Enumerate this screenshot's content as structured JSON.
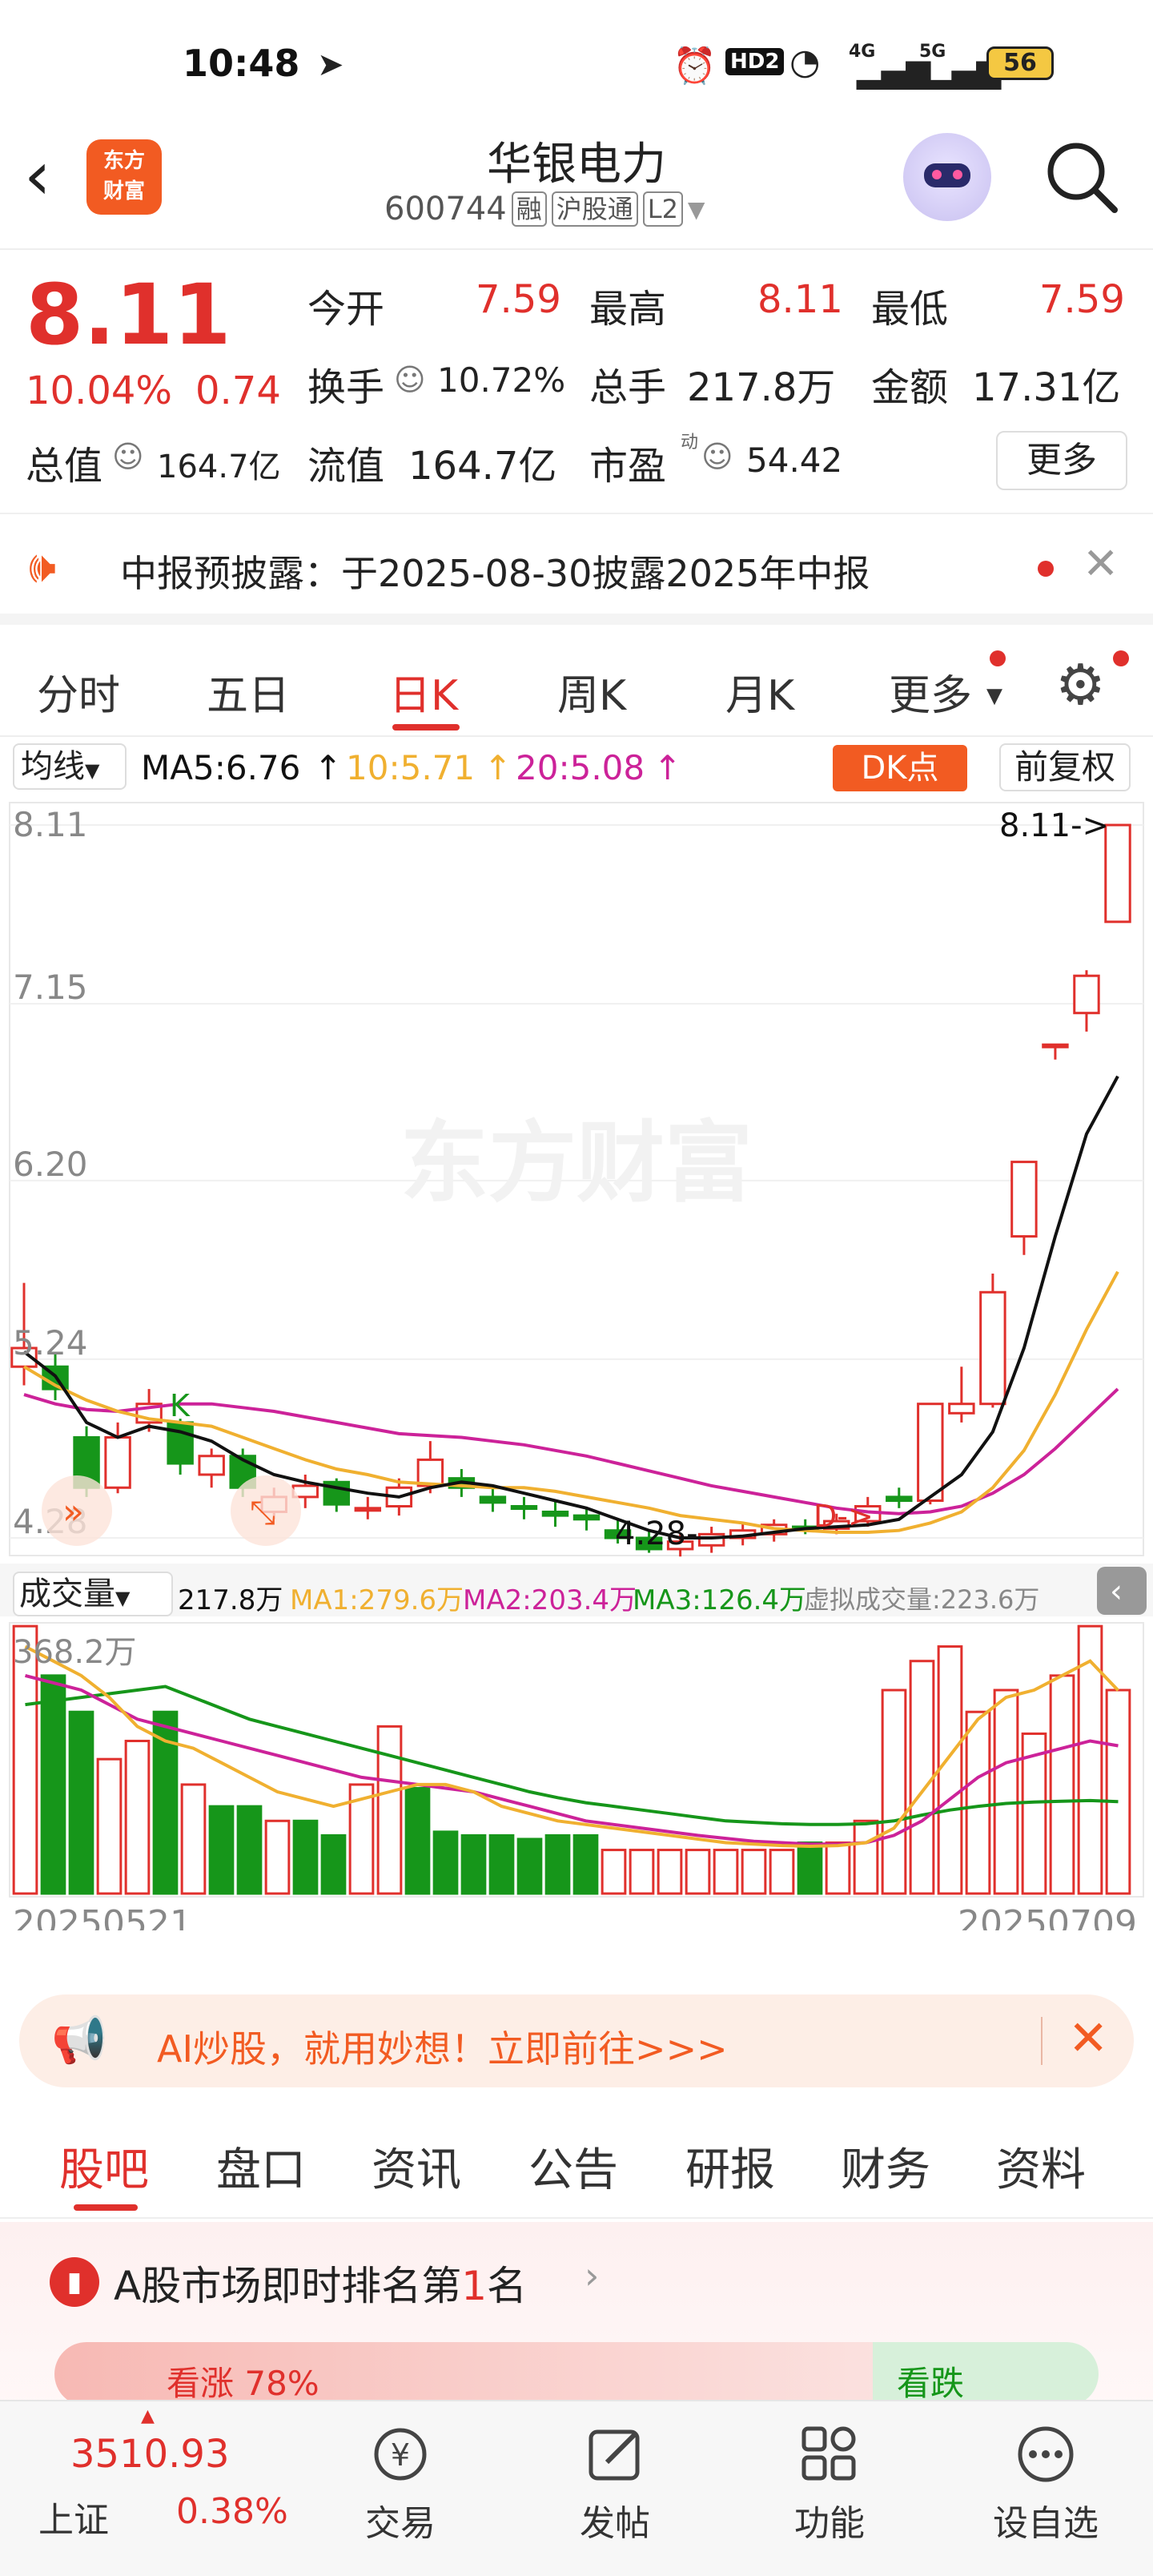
{
  "status_bar": {
    "time": "10:48",
    "hd": "HD2",
    "net4g": "4G",
    "net5g": "5G",
    "battery": "56"
  },
  "header": {
    "logo_text_1": "东方",
    "logo_text_2": "财富",
    "title": "华银电力",
    "code": "600744",
    "tag_rong": "融",
    "tag_hgt": "沪股通",
    "tag_l2": "L2"
  },
  "quote": {
    "price": "8.11",
    "change_pct": "10.04%",
    "change_amt": "0.74",
    "open_label": "今开",
    "open": "7.59",
    "high_label": "最高",
    "high": "8.11",
    "low_label": "最低",
    "low": "7.59",
    "turnover_label": "换手",
    "turnover": "10.72%",
    "volume_label": "总手",
    "volume": "217.8万",
    "amount_label": "金额",
    "amount": "17.31亿",
    "mktcap_label": "总值",
    "mktcap": "164.7亿",
    "float_label": "流值",
    "float": "164.7亿",
    "pe_label": "市盈",
    "pe_sup": "动",
    "pe": "54.42",
    "more": "更多"
  },
  "notice": {
    "text": "中报预披露：于2025-08-30披露2025年中报"
  },
  "period_tabs": [
    "分时",
    "五日",
    "日K",
    "周K",
    "月K",
    "更多"
  ],
  "ma_bar": {
    "selector": "均线",
    "ma5": "MA5:6.76",
    "ma10": "10:5.71",
    "ma20": "20:5.08",
    "dk": "DK点",
    "adjust": "前复权"
  },
  "price_axis": [
    "8.11",
    "7.15",
    "6.20",
    "5.24",
    "4.28"
  ],
  "chart_annotations": {
    "last": "8.11->",
    "low": "4.28-",
    "k_mark": "K",
    "d_mark": "D->",
    "watermark": "东方财富"
  },
  "volume_bar": {
    "selector": "成交量",
    "vol": "217.8万",
    "ma1": "MA1:279.6万",
    "ma2": "MA2:203.4万",
    "ma3": "MA3:126.4万",
    "virtual": "虚拟成交量:223.6万",
    "max": "368.2万"
  },
  "dates": {
    "start": "20250521",
    "end": "20250709"
  },
  "colors": {
    "up": "#e0302c",
    "down": "#16961a",
    "ma5": "#111111",
    "ma10": "#f0b030",
    "ma20": "#cc2299",
    "vma3": "#16961a"
  },
  "chart_data": [
    {
      "type": "candlestick",
      "title": "日K",
      "ylim": [
        4.28,
        8.11
      ],
      "x_start": "20250521",
      "x_end": "20250709",
      "candles": [
        {
          "o": 5.2,
          "c": 5.3,
          "h": 5.65,
          "l": 5.1
        },
        {
          "o": 5.2,
          "c": 5.08,
          "h": 5.28,
          "l": 5.02
        },
        {
          "o": 4.82,
          "c": 4.55,
          "h": 4.88,
          "l": 4.5
        },
        {
          "o": 4.55,
          "c": 4.82,
          "h": 4.9,
          "l": 4.52
        },
        {
          "o": 4.9,
          "c": 5.0,
          "h": 5.08,
          "l": 4.85
        },
        {
          "o": 4.9,
          "c": 4.68,
          "h": 4.92,
          "l": 4.62
        },
        {
          "o": 4.62,
          "c": 4.72,
          "h": 4.76,
          "l": 4.55
        },
        {
          "o": 4.72,
          "c": 4.55,
          "h": 4.76,
          "l": 4.5
        },
        {
          "o": 4.42,
          "c": 4.5,
          "h": 4.55,
          "l": 4.38
        },
        {
          "o": 4.5,
          "c": 4.56,
          "h": 4.62,
          "l": 4.44
        },
        {
          "o": 4.58,
          "c": 4.46,
          "h": 4.6,
          "l": 4.42
        },
        {
          "o": 4.44,
          "c": 4.44,
          "h": 4.5,
          "l": 4.38
        },
        {
          "o": 4.45,
          "c": 4.55,
          "h": 4.6,
          "l": 4.4
        },
        {
          "o": 4.56,
          "c": 4.7,
          "h": 4.8,
          "l": 4.52
        },
        {
          "o": 4.6,
          "c": 4.55,
          "h": 4.65,
          "l": 4.5
        },
        {
          "o": 4.5,
          "c": 4.47,
          "h": 4.55,
          "l": 4.42
        },
        {
          "o": 4.45,
          "c": 4.44,
          "h": 4.5,
          "l": 4.38
        },
        {
          "o": 4.42,
          "c": 4.4,
          "h": 4.48,
          "l": 4.34
        },
        {
          "o": 4.4,
          "c": 4.38,
          "h": 4.44,
          "l": 4.32
        },
        {
          "o": 4.32,
          "c": 4.28,
          "h": 4.38,
          "l": 4.25
        },
        {
          "o": 4.28,
          "c": 4.22,
          "h": 4.32,
          "l": 4.2
        },
        {
          "o": 4.22,
          "c": 4.26,
          "h": 4.3,
          "l": 4.18
        },
        {
          "o": 4.24,
          "c": 4.3,
          "h": 4.34,
          "l": 4.2
        },
        {
          "o": 4.28,
          "c": 4.32,
          "h": 4.36,
          "l": 4.24
        },
        {
          "o": 4.3,
          "c": 4.35,
          "h": 4.38,
          "l": 4.26
        },
        {
          "o": 4.34,
          "c": 4.33,
          "h": 4.38,
          "l": 4.3
        },
        {
          "o": 4.33,
          "c": 4.37,
          "h": 4.41,
          "l": 4.3
        },
        {
          "o": 4.37,
          "c": 4.45,
          "h": 4.5,
          "l": 4.34
        },
        {
          "o": 4.5,
          "c": 4.48,
          "h": 4.55,
          "l": 4.44
        },
        {
          "o": 4.48,
          "c": 5.0,
          "h": 5.0,
          "l": 4.46
        },
        {
          "o": 4.95,
          "c": 5.0,
          "h": 5.2,
          "l": 4.9
        },
        {
          "o": 5.0,
          "c": 5.6,
          "h": 5.7,
          "l": 4.98
        },
        {
          "o": 5.9,
          "c": 6.3,
          "h": 6.3,
          "l": 5.8
        },
        {
          "o": 6.93,
          "c": 6.93,
          "h": 6.93,
          "l": 6.85
        },
        {
          "o": 7.1,
          "c": 7.3,
          "h": 7.33,
          "l": 7.0
        },
        {
          "o": 7.59,
          "c": 8.11,
          "h": 8.11,
          "l": 7.59
        }
      ],
      "ma5_points": [
        5.28,
        5.15,
        4.9,
        4.82,
        4.88,
        4.85,
        4.8,
        4.7,
        4.62,
        4.58,
        4.55,
        4.52,
        4.5,
        4.55,
        4.58,
        4.56,
        4.52,
        4.48,
        4.44,
        4.38,
        4.32,
        4.28,
        4.28,
        4.29,
        4.31,
        4.33,
        4.34,
        4.35,
        4.38,
        4.5,
        4.62,
        4.85,
        5.3,
        5.9,
        6.45,
        6.76
      ],
      "ma10_points": [
        5.2,
        5.1,
        5.02,
        4.96,
        4.92,
        4.9,
        4.88,
        4.82,
        4.76,
        4.7,
        4.65,
        4.62,
        4.58,
        4.57,
        4.56,
        4.55,
        4.55,
        4.53,
        4.5,
        4.47,
        4.44,
        4.4,
        4.38,
        4.36,
        4.33,
        4.32,
        4.31,
        4.31,
        4.32,
        4.36,
        4.42,
        4.55,
        4.75,
        5.05,
        5.4,
        5.71
      ],
      "ma20_points": [
        5.05,
        5.0,
        4.97,
        4.96,
        4.98,
        5.0,
        5.0,
        4.98,
        4.96,
        4.93,
        4.9,
        4.87,
        4.84,
        4.83,
        4.82,
        4.8,
        4.78,
        4.75,
        4.72,
        4.68,
        4.64,
        4.6,
        4.56,
        4.53,
        4.5,
        4.47,
        4.44,
        4.42,
        4.41,
        4.42,
        4.45,
        4.52,
        4.62,
        4.76,
        4.92,
        5.08
      ]
    },
    {
      "type": "bar",
      "title": "成交量",
      "unit": "万",
      "ylim": [
        0,
        368.2
      ],
      "values": [
        368,
        300,
        250,
        185,
        210,
        250,
        150,
        120,
        120,
        100,
        100,
        80,
        150,
        230,
        145,
        85,
        80,
        80,
        75,
        80,
        80,
        60,
        60,
        60,
        60,
        60,
        60,
        60,
        70,
        70,
        100,
        280,
        320,
        340,
        250,
        280,
        220,
        300,
        368,
        280
      ],
      "directions": [
        "u",
        "d",
        "d",
        "u",
        "u",
        "d",
        "u",
        "d",
        "d",
        "u",
        "d",
        "d",
        "u",
        "u",
        "d",
        "d",
        "d",
        "d",
        "d",
        "d",
        "d",
        "u",
        "u",
        "u",
        "u",
        "u",
        "u",
        "u",
        "d",
        "u",
        "u",
        "u",
        "u",
        "u",
        "u",
        "u",
        "u",
        "u",
        "u",
        "u"
      ],
      "ma1_points": [
        340,
        320,
        300,
        270,
        230,
        210,
        200,
        180,
        160,
        140,
        130,
        120,
        130,
        140,
        150,
        150,
        140,
        120,
        110,
        100,
        95,
        90,
        85,
        80,
        75,
        70,
        68,
        66,
        65,
        66,
        70,
        90,
        140,
        190,
        240,
        270,
        280,
        300,
        320,
        279.6
      ],
      "ma2_points": [
        300,
        290,
        280,
        260,
        240,
        230,
        220,
        210,
        200,
        190,
        180,
        170,
        160,
        155,
        150,
        145,
        140,
        130,
        120,
        110,
        100,
        95,
        90,
        85,
        80,
        76,
        72,
        70,
        68,
        68,
        70,
        80,
        100,
        130,
        160,
        180,
        190,
        200,
        210,
        203.4
      ],
      "ma3_points": [
        260,
        265,
        270,
        275,
        280,
        285,
        270,
        255,
        240,
        230,
        220,
        210,
        200,
        190,
        180,
        170,
        160,
        150,
        140,
        132,
        125,
        120,
        115,
        110,
        105,
        100,
        98,
        96,
        95,
        95,
        96,
        100,
        108,
        115,
        120,
        124,
        126,
        127,
        128,
        126.4
      ]
    }
  ],
  "ai_banner": {
    "text": "AI炒股，就用妙想！立即前往>>>"
  },
  "info_tabs": [
    "股吧",
    "盘口",
    "资讯",
    "公告",
    "研报",
    "财务",
    "资料"
  ],
  "rank": {
    "prefix": "A股市场即时排名第",
    "num": "1",
    "suffix": "名",
    "bull": "看涨 78%",
    "bear": "看跌"
  },
  "bottom_nav": {
    "index_value": "3510.93",
    "index_name": "上证",
    "index_pct": "0.38%",
    "trade": "交易",
    "post": "发帖",
    "func": "功能",
    "watchlist": "设自选"
  }
}
